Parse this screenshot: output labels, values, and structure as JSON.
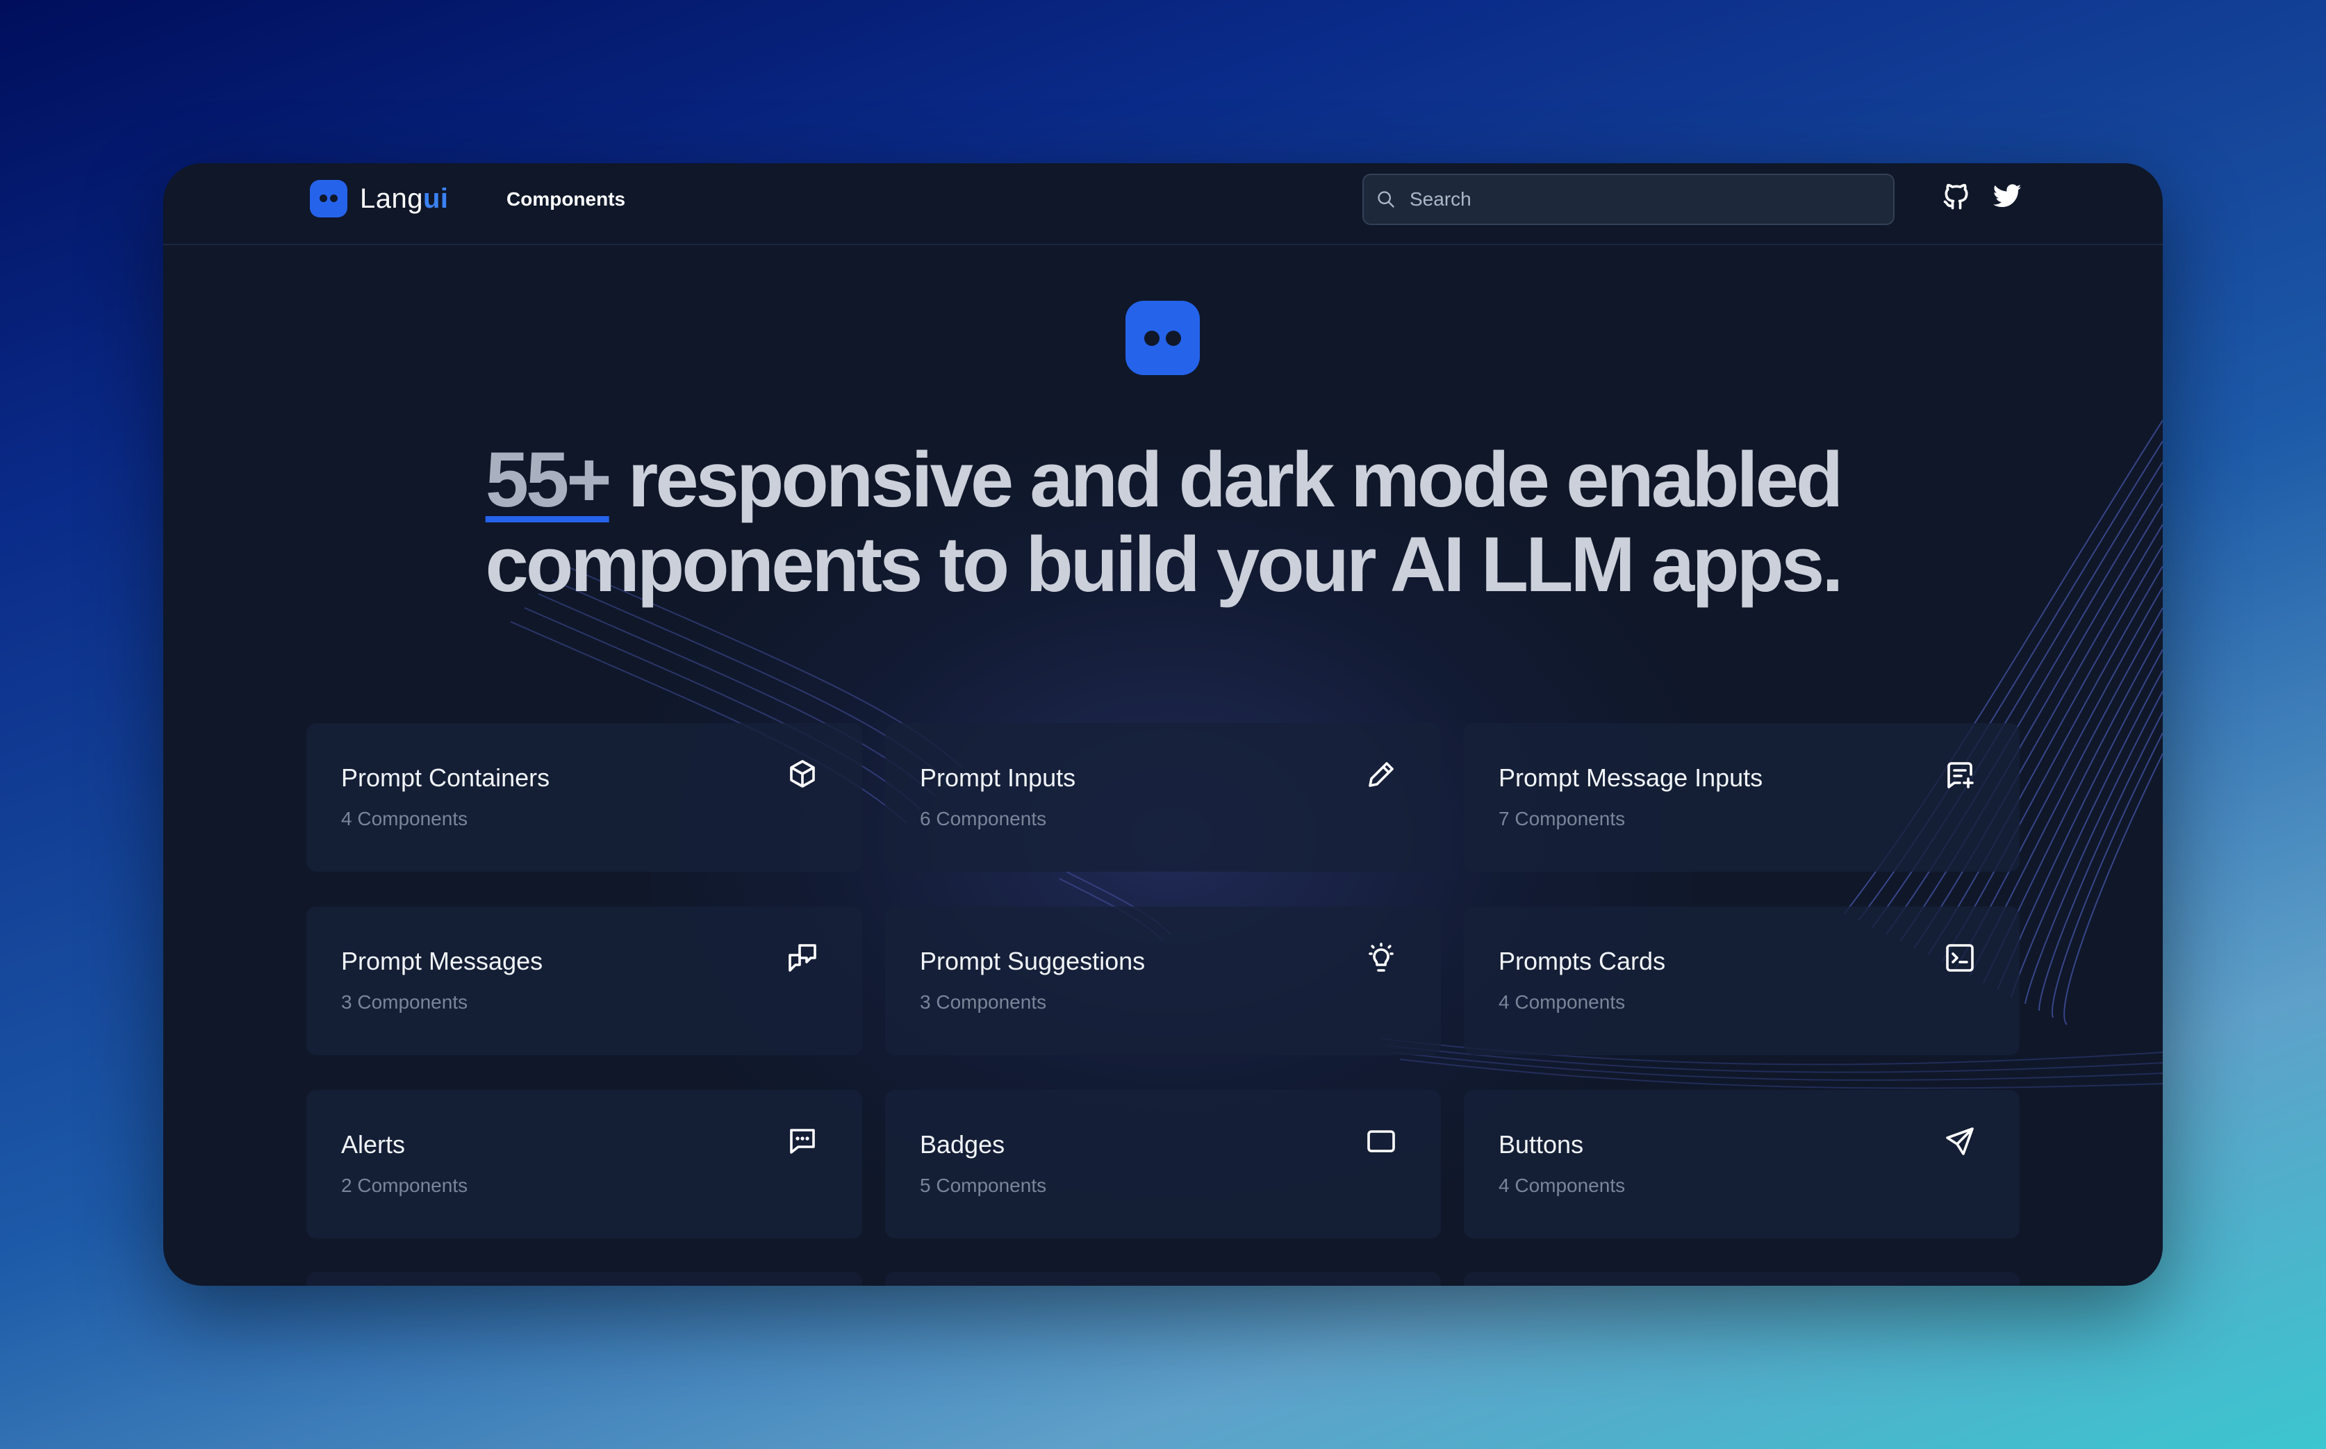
{
  "nav": {
    "logo_prefix": "Lang",
    "logo_suffix": "ui",
    "components_link": "Components",
    "search_placeholder": "Search",
    "github_icon": "github-icon",
    "twitter_icon": "twitter-icon"
  },
  "hero": {
    "headline_lead": "55+",
    "headline_rest_line1": " responsive and dark mode enabled",
    "headline_line2": "components to build your AI LLM apps."
  },
  "cards": [
    {
      "title": "Prompt Containers",
      "count": "4 Components",
      "icon": "cube-icon"
    },
    {
      "title": "Prompt Inputs",
      "count": "6 Components",
      "icon": "pencil-icon"
    },
    {
      "title": "Prompt Message Inputs",
      "count": "7 Components",
      "icon": "message-plus-icon"
    },
    {
      "title": "Prompt Messages",
      "count": "3 Components",
      "icon": "messages-icon"
    },
    {
      "title": "Prompt Suggestions",
      "count": "3 Components",
      "icon": "bulb-icon"
    },
    {
      "title": "Prompts Cards",
      "count": "4 Components",
      "icon": "terminal-icon"
    },
    {
      "title": "Alerts",
      "count": "2 Components",
      "icon": "message-dots-icon"
    },
    {
      "title": "Badges",
      "count": "5 Components",
      "icon": "rectangle-icon"
    },
    {
      "title": "Buttons",
      "count": "4 Components",
      "icon": "send-icon"
    }
  ],
  "colors": {
    "accent": "#2563eb",
    "window_bg": "#0f1729",
    "card_bg": "#162038"
  }
}
